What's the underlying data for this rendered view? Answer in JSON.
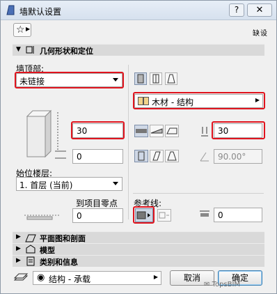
{
  "window": {
    "title": "墙默认设置",
    "help_label": "?",
    "close_label": "✕"
  },
  "toolbar": {
    "favorites_icon": "star-icon",
    "mode_label": "缺设"
  },
  "sections": {
    "geometry": "几何形状和定位",
    "plan_section": "平面图和剖面",
    "model": "模型",
    "classification": "类别和信息"
  },
  "geometry": {
    "top_label": "墙顶部:",
    "top_value": "未链接",
    "height_value": "30",
    "offset_value": "0",
    "home_story_label": "始位楼层:",
    "home_story_value": "1. 首层 (当前)",
    "to_zero_label": "到项目零点",
    "to_zero_value": "0",
    "building_material": "木材 - 结构",
    "thickness_value": "30",
    "slant_value": "90.00°",
    "reference_line_label": "参考线:",
    "ref_offset_value": "0"
  },
  "footer": {
    "layer_value": "结构 - 承载",
    "cancel_label": "取消",
    "ok_label": "确定"
  },
  "watermark": "TopsBIM",
  "colors": {
    "highlight": "#e0141e",
    "section_bg": "#d9d9d9"
  }
}
